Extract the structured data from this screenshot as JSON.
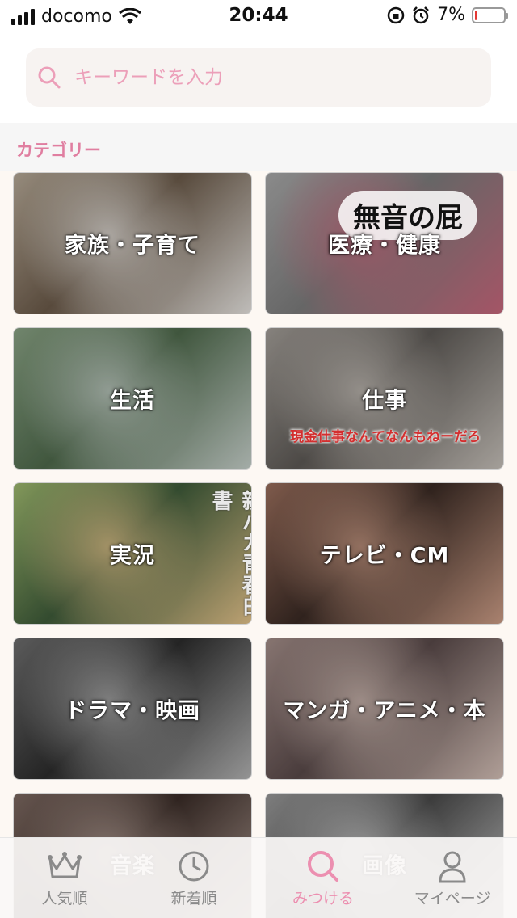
{
  "status_bar": {
    "carrier": "docomo",
    "time": "20:44",
    "battery": "7%",
    "battery_level": 0.07
  },
  "search": {
    "placeholder": "キーワードを入力"
  },
  "section": {
    "title": "カテゴリー"
  },
  "categories": [
    {
      "label": "家族・子育て",
      "colors": [
        "#6c5b4a",
        "#b7aa98",
        "#e9e6e2"
      ]
    },
    {
      "label": "医療・健康",
      "image_text": "無音の屁",
      "colors": [
        "#7d7d7d",
        "#a9a9a9",
        "#c9687d"
      ]
    },
    {
      "label": "生活",
      "colors": [
        "#4f6a4c",
        "#8aa385",
        "#c8d2cc"
      ]
    },
    {
      "label": "仕事",
      "image_text": "現金仕事なんてなんもねーだろ",
      "colors": [
        "#5e5a56",
        "#a49f99",
        "#c8c2bb"
      ]
    },
    {
      "label": "実況",
      "image_text": "親バカ青春白書",
      "colors": [
        "#3f5c3a",
        "#9fb96f",
        "#e6c58c"
      ]
    },
    {
      "label": "テレビ・CM",
      "colors": [
        "#3a2a24",
        "#9b6f5d",
        "#cf9f88"
      ]
    },
    {
      "label": "ドラマ・映画",
      "colors": [
        "#2d2d2d",
        "#6f6f6f",
        "#b5b5b5"
      ]
    },
    {
      "label": "マンガ・アニメ・本",
      "colors": [
        "#5a4a4a",
        "#a58f8a",
        "#d7c2b9"
      ]
    },
    {
      "label": "音楽",
      "colors": [
        "#3b2d28",
        "#7e6a62",
        "#b9a49b"
      ]
    },
    {
      "label": "画像",
      "colors": [
        "#4a4a4a",
        "#9a9a9a",
        "#d2d2d2"
      ]
    }
  ],
  "bottom_nav": {
    "items": [
      {
        "label": "人気順",
        "icon": "crown-icon",
        "active": false
      },
      {
        "label": "新着順",
        "icon": "clock-icon",
        "active": false
      },
      {
        "label": "みつける",
        "icon": "search-icon",
        "active": true
      },
      {
        "label": "マイページ",
        "icon": "person-icon",
        "active": false
      }
    ]
  },
  "colors": {
    "accent": "#ec8fb0",
    "section_title": "#e07ea0"
  }
}
